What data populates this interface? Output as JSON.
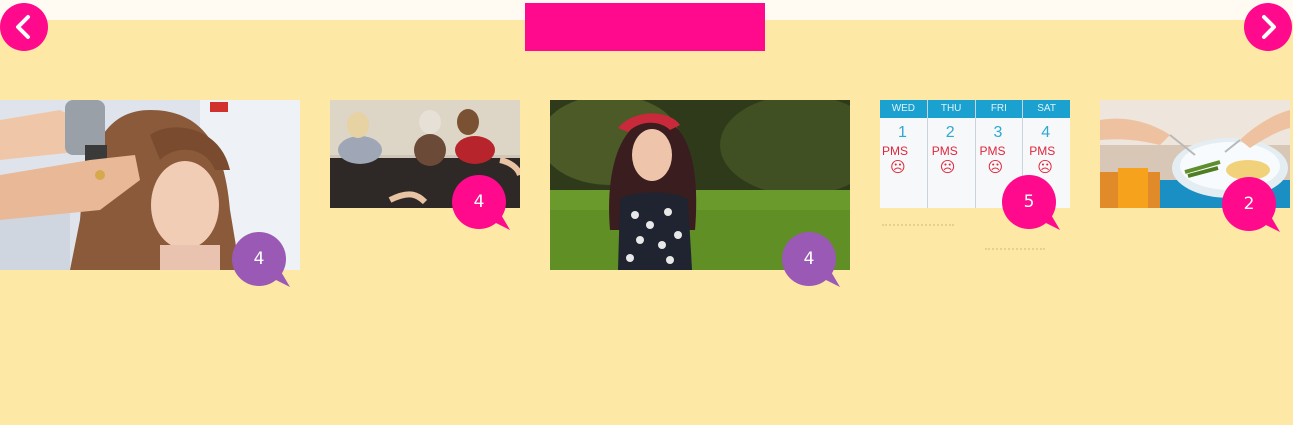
{
  "navigation": {
    "prev_icon": "chevron-left-icon",
    "next_icon": "chevron-right-icon"
  },
  "colors": {
    "page_bg": "#fde8a5",
    "top_strip": "#fffbf2",
    "accent_pink": "#ff0a8c",
    "bubble_purple": "#9b59b6",
    "bubble_pink": "#ff0a8c"
  },
  "cards": [
    {
      "scene": "hair-drying",
      "comment_count": "4",
      "bubble_color": "purple"
    },
    {
      "scene": "three-women-on-couch",
      "comment_count": "4",
      "bubble_color": "pink"
    },
    {
      "scene": "woman-with-headscarf-in-park",
      "comment_count": "4",
      "bubble_color": "purple"
    },
    {
      "scene": "pms-calendar",
      "comment_count": "5",
      "bubble_color": "pink",
      "calendar": {
        "days": [
          "WED",
          "THU",
          "FRI",
          "SAT"
        ],
        "dates": [
          "1",
          "2",
          "3",
          "4"
        ],
        "notes": [
          "PMS",
          "PMS",
          "PMS",
          "PMS"
        ]
      }
    },
    {
      "scene": "plate-of-food",
      "comment_count": "2",
      "bubble_color": "pink"
    }
  ]
}
